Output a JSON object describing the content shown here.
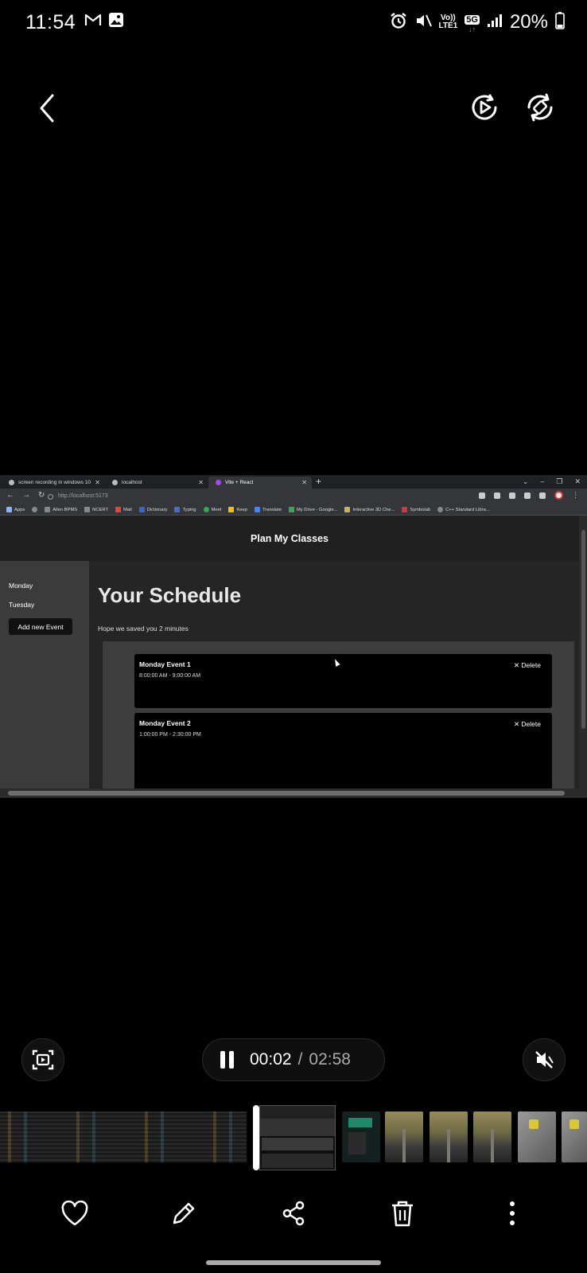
{
  "status_bar": {
    "time": "11:54",
    "battery": "20%",
    "volte": "Vo))",
    "lte": "LTE1",
    "network": "5G",
    "icons": [
      "gmail-icon",
      "gallery-icon",
      "alarm-icon",
      "mute-icon",
      "signal-icon",
      "battery-icon"
    ]
  },
  "viewer": {
    "icons": [
      "back-icon",
      "rotate-play-icon",
      "auto-rotate-icon"
    ]
  },
  "browser": {
    "tabs": [
      {
        "label": "screen recording in windows 10",
        "active": false
      },
      {
        "label": "localhost",
        "active": false
      },
      {
        "label": "Vite + React",
        "active": true
      }
    ],
    "url": "http://localhost:5173",
    "bookmarks": [
      "Apps",
      "Allen BPMS",
      "NCERT",
      "Mail",
      "Dictionary",
      "Typing",
      "Meet",
      "Keep",
      "Translate",
      "My Drive - Google...",
      "Interactive 3D Che...",
      "Symbolab",
      "C++ Standard Libra..."
    ]
  },
  "app": {
    "header_title": "Plan My Classes",
    "sidebar": {
      "items": [
        "Monday",
        "Tuesday"
      ],
      "add_button": "Add new Event"
    },
    "main": {
      "title": "Your Schedule",
      "subtitle": "Hope we saved you 2 minutes",
      "events": [
        {
          "title": "Monday Event 1",
          "time": "8:00:00 AM - 9:00:00 AM",
          "delete_label": "Delete"
        },
        {
          "title": "Monday Event 2",
          "time": "1:00:00 PM - 2:30:00 PM",
          "delete_label": "Delete"
        }
      ]
    }
  },
  "player": {
    "current_time": "00:02",
    "separator": "/",
    "total_time": "02:58",
    "progress_fraction": 0.011,
    "icons": [
      "screen-capture-icon",
      "pause-icon",
      "mute-icon"
    ]
  },
  "actions": {
    "icons": [
      "heart-icon",
      "edit-icon",
      "share-icon",
      "delete-icon",
      "more-icon"
    ]
  }
}
